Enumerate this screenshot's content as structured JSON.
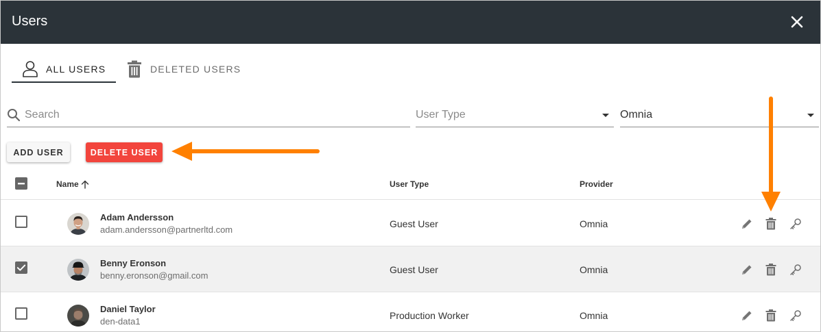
{
  "dialog": {
    "title": "Users"
  },
  "tabs": [
    {
      "label": "ALL USERS",
      "icon": "person-icon",
      "active": true
    },
    {
      "label": "DELETED USERS",
      "icon": "trash-icon",
      "active": false
    }
  ],
  "filters": {
    "search_placeholder": "Search",
    "user_type_placeholder": "User Type",
    "provider_value": "Omnia"
  },
  "toolbar": {
    "add_label": "ADD USER",
    "delete_label": "DELETE USER"
  },
  "table": {
    "columns": {
      "name": "Name",
      "user_type": "User Type",
      "provider": "Provider"
    },
    "sort": {
      "column": "name",
      "direction": "ascending"
    },
    "rows": [
      {
        "name": "Adam Andersson",
        "email": "adam.andersson@partnerltd.com",
        "user_type": "Guest User",
        "provider": "Omnia",
        "checked": false
      },
      {
        "name": "Benny Eronson",
        "email": "benny.eronson@gmail.com",
        "user_type": "Guest User",
        "provider": "Omnia",
        "checked": true
      },
      {
        "name": "Daniel Taylor",
        "email": "den-data1",
        "user_type": "Production Worker",
        "provider": "Omnia",
        "checked": false
      }
    ]
  },
  "colors": {
    "titlebar": "#2b3339",
    "delete_button": "#f2453d",
    "annotation_arrow": "#ff8000",
    "selected_row": "#f1f1f1"
  }
}
